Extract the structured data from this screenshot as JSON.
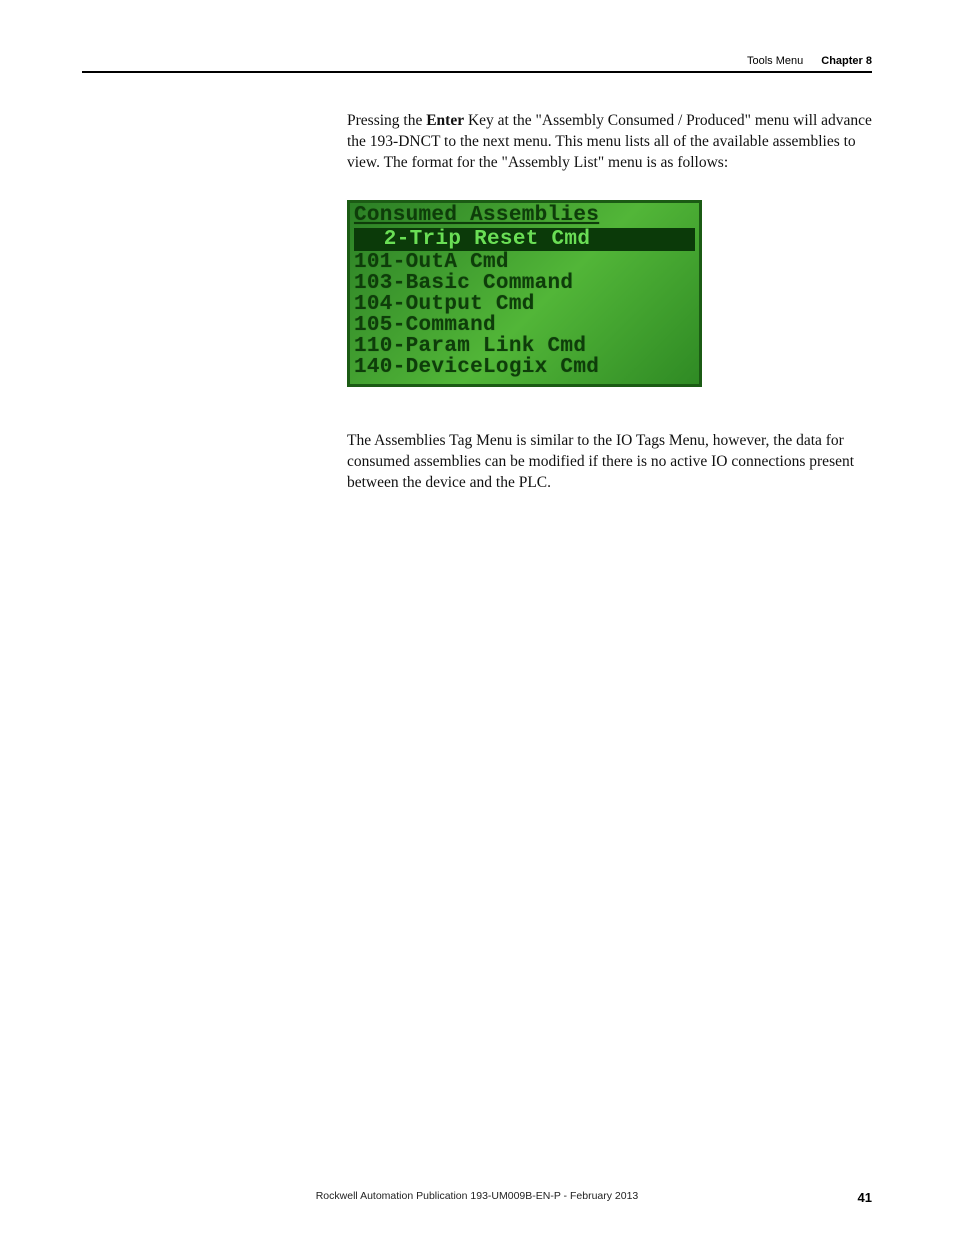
{
  "header": {
    "tools_label": "Tools Menu",
    "chapter_label": "Chapter 8"
  },
  "paragraphs": {
    "p1_pre": "Pressing the ",
    "p1_enter": "Enter",
    "p1_post": " Key at the \"Assembly Consumed / Produced\" menu will advance the 193-DNCT to the next menu. This menu lists all of the available assemblies to view. The format for the \"Assembly List\" menu is as follows:",
    "p2": "The Assemblies Tag Menu is similar to the IO Tags Menu, however, the data for consumed assemblies can be modified if there is no active IO connections present between the device and the PLC."
  },
  "lcd": {
    "title": "Consumed Assemblies",
    "selected": "  2-Trip Reset Cmd",
    "rows": [
      "101-OutA Cmd",
      "103-Basic Command",
      "104-Output Cmd",
      "105-Command",
      "110-Param Link Cmd",
      "140-DeviceLogix Cmd"
    ]
  },
  "footer": {
    "publication": "Rockwell Automation Publication 193-UM009B-EN-P - February 2013",
    "page_number": "41"
  }
}
